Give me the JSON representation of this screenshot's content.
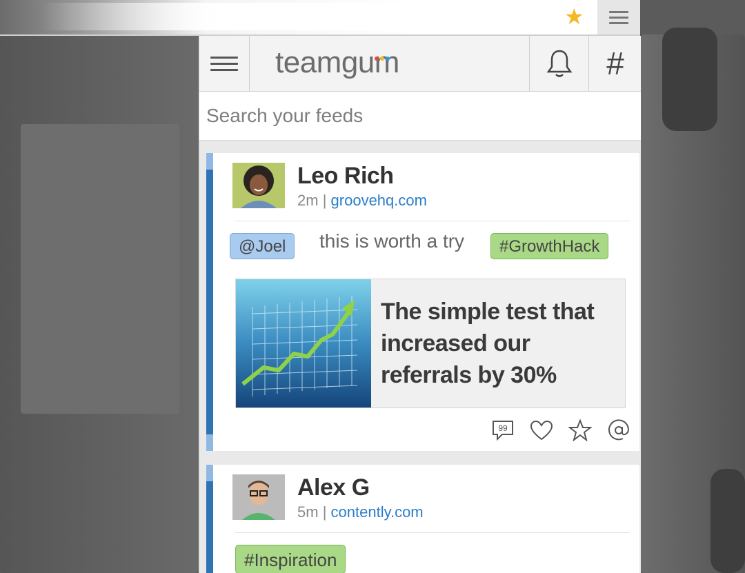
{
  "panel": {
    "logo_text": "teamgum",
    "logo_dot_colors": [
      "#e84545",
      "#f4b822",
      "#2a9ee0"
    ],
    "search_placeholder": "Search your feeds"
  },
  "colors": {
    "accent_blue": "#2e74b5",
    "link": "#2a7dc9",
    "mention_tag": "#a9cbef",
    "hashtag_tag": "#a9d986",
    "bookmark_star": "#f4b822"
  },
  "feed": [
    {
      "author": "Leo Rich",
      "time": "2m",
      "separator": "|",
      "source": "groovehq.com",
      "mention": "@Joel",
      "message": "this is worth a try",
      "hashtag": "#GrowthHack",
      "preview_title": "The simple test that increased our referrals by 30%",
      "actions": [
        "comment-icon",
        "heart-icon",
        "star-icon",
        "at-icon"
      ]
    },
    {
      "author": "Alex G",
      "time": "5m",
      "separator": "|",
      "source": "contently.com",
      "hashtag": "#Inspiration"
    }
  ]
}
